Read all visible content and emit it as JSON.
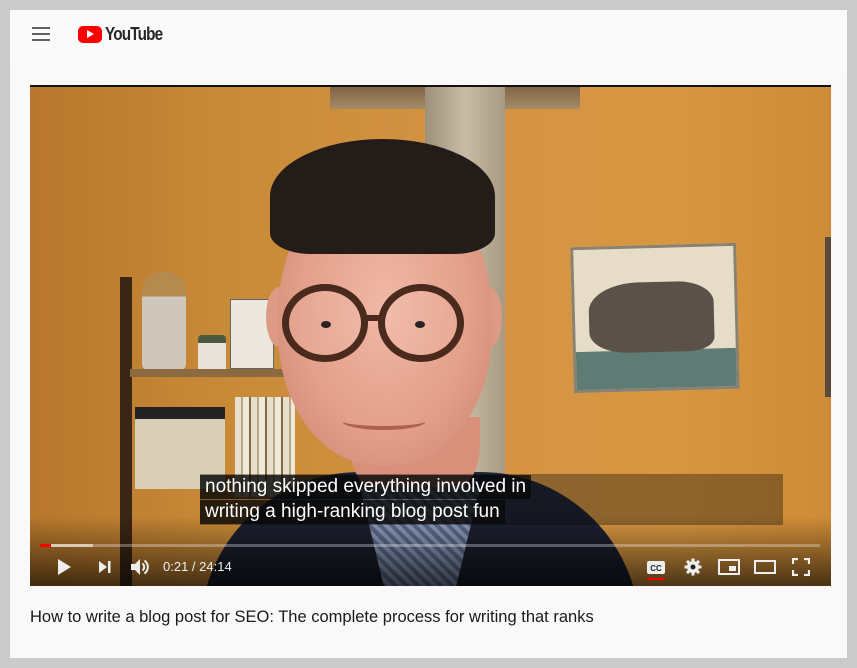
{
  "header": {
    "menu_icon": "hamburger-menu-icon",
    "logo_text": "YouTube"
  },
  "player": {
    "captions": {
      "line1": "nothing skipped everything involved in",
      "line2": "writing a high-ranking blog post fun"
    },
    "progress": {
      "played_fraction": 0.0145,
      "buffered_fraction": 0.068
    },
    "time": {
      "current": "0:21",
      "separator": " / ",
      "duration": "24:14",
      "display": "0:21 / 24:14"
    },
    "controls": {
      "play": "play-icon",
      "next": "next-icon",
      "volume": "volume-icon",
      "captions": "cc-icon",
      "settings": "gear-icon",
      "miniplayer": "miniplayer-icon",
      "theater": "theater-mode-icon",
      "fullscreen": "fullscreen-icon"
    },
    "captions_enabled": true
  },
  "video": {
    "title": "How to write a blog post for SEO: The complete process for writing that ranks"
  },
  "colors": {
    "brand_red": "#ff0000",
    "progress_played": "#ff0000",
    "cc_active": "#ff0000"
  }
}
